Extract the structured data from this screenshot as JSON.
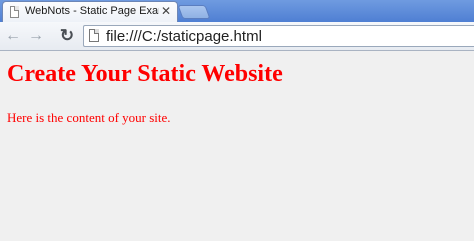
{
  "browser": {
    "tab": {
      "title": "WebNots - Static Page Exam",
      "close_glyph": "✕",
      "icon": "page-icon"
    },
    "new_tab_icon": "new-tab-icon",
    "toolbar": {
      "back_glyph": "←",
      "forward_glyph": "→",
      "reload_glyph": "↻",
      "url": "file:///C:/staticpage.html"
    }
  },
  "page": {
    "heading": "Create Your Static Website",
    "paragraph": "Here is the content of your site.",
    "text_color": "#ff0000",
    "background": "#f0f0f0"
  }
}
